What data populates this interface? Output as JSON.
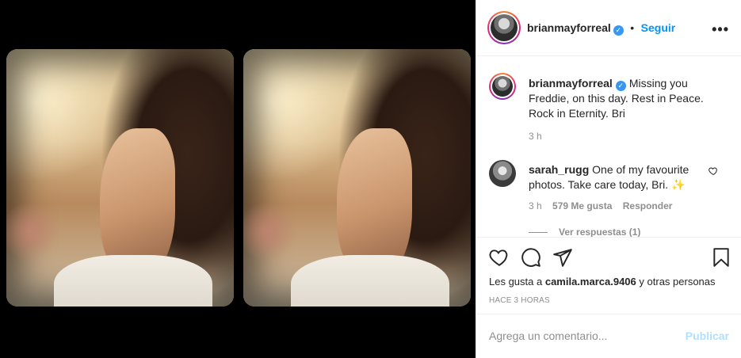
{
  "post": {
    "username": "brianmayforreal",
    "follow_label": "Seguir",
    "separator": "•",
    "more_label": "•••"
  },
  "caption": {
    "username": "brianmayforreal",
    "text": "Missing you Freddie, on this day. Rest in Peace. Rock in Eternity. Bri",
    "time": "3 h"
  },
  "comments": [
    {
      "username": "sarah_rugg",
      "text": "One of my favourite photos. Take care today, Bri. ✨",
      "time": "3 h",
      "likes": "579 Me gusta",
      "reply_label": "Responder",
      "view_replies": "Ver respuestas (1)"
    }
  ],
  "likes": {
    "prefix": "Les gusta a",
    "user": "camila.marca.9406",
    "suffix": "y otras personas"
  },
  "posted_ago": "HACE 3 HORAS",
  "add_comment": {
    "placeholder": "Agrega un comentario...",
    "publish_label": "Publicar"
  },
  "colors": {
    "accent": "#0095f6",
    "verified": "#3897f0",
    "muted": "#8e8e8e",
    "publish_disabled": "#b2dffc"
  },
  "icons": [
    "verified-badge-icon",
    "heart-icon",
    "comment-icon",
    "share-icon",
    "bookmark-icon",
    "more-options-icon"
  ]
}
